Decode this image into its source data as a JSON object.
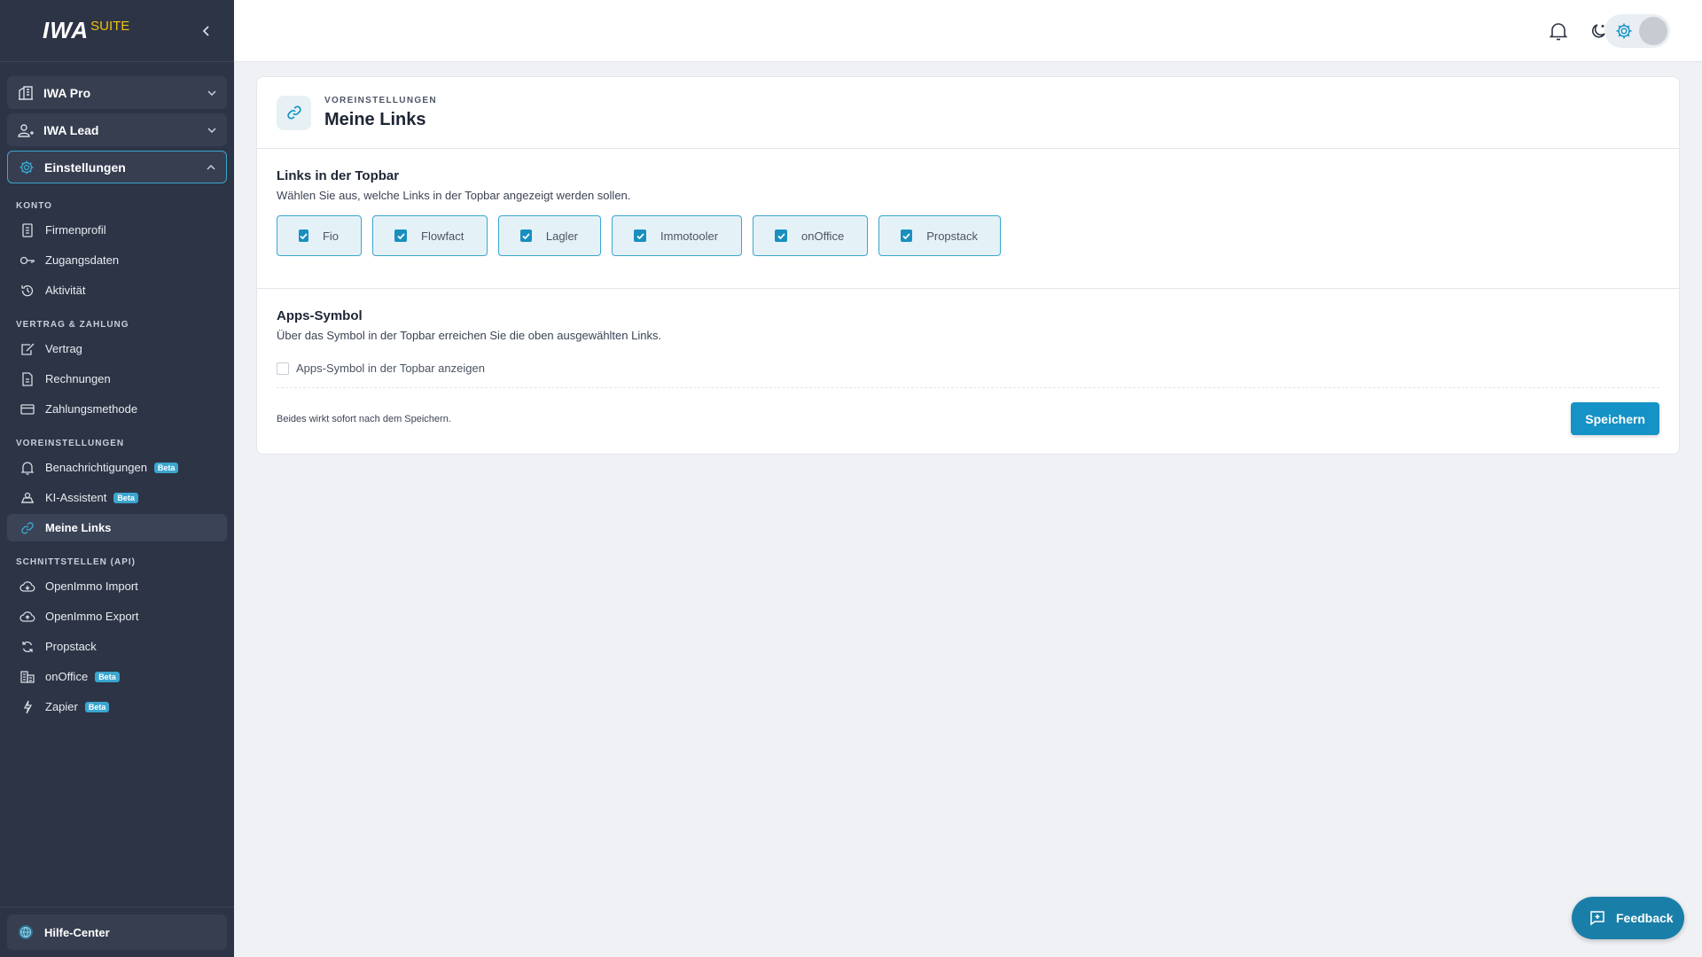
{
  "brand": {
    "name": "IWA",
    "suffix": "SUITE",
    "accent": "#f1c40f"
  },
  "colors": {
    "primary": "#1592c6",
    "sidebar": "#2d3445",
    "beta_badge": "#3aa6cf"
  },
  "sidebar": {
    "groups": [
      {
        "label": "IWA Pro",
        "icon": "building-icon",
        "expanded": false
      },
      {
        "label": "IWA Lead",
        "icon": "user-add-icon",
        "expanded": false
      },
      {
        "label": "Einstellungen",
        "icon": "gear-icon",
        "expanded": true
      }
    ],
    "sections": [
      {
        "title": "KONTO",
        "items": [
          {
            "label": "Firmenprofil",
            "icon": "document-icon"
          },
          {
            "label": "Zugangsdaten",
            "icon": "key-icon"
          },
          {
            "label": "Aktivität",
            "icon": "history-icon"
          }
        ]
      },
      {
        "title": "VERTRAG & ZAHLUNG",
        "items": [
          {
            "label": "Vertrag",
            "icon": "contract-icon"
          },
          {
            "label": "Rechnungen",
            "icon": "invoice-icon"
          },
          {
            "label": "Zahlungsmethode",
            "icon": "credit-card-icon"
          }
        ]
      },
      {
        "title": "VOREINSTELLUNGEN",
        "items": [
          {
            "label": "Benachrichtigungen",
            "icon": "bell-icon",
            "badge": "Beta"
          },
          {
            "label": "KI-Assistent",
            "icon": "robot-icon",
            "badge": "Beta"
          },
          {
            "label": "Meine Links",
            "icon": "link-icon",
            "active": true
          }
        ]
      },
      {
        "title": "SCHNITTSTELLEN (API)",
        "items": [
          {
            "label": "OpenImmo Import",
            "icon": "cloud-icon"
          },
          {
            "label": "OpenImmo Export",
            "icon": "cloud-icon"
          },
          {
            "label": "Propstack",
            "icon": "sync-icon"
          },
          {
            "label": "onOffice",
            "icon": "office-building-icon",
            "badge": "Beta"
          },
          {
            "label": "Zapier",
            "icon": "bolt-icon",
            "badge": "Beta"
          }
        ]
      }
    ],
    "help": {
      "label": "Hilfe-Center",
      "icon": "globe-icon"
    }
  },
  "topbar": {
    "icons": [
      "bell-icon",
      "moon-icon",
      "gear-icon"
    ]
  },
  "card": {
    "eyebrow": "VOREINSTELLUNGEN",
    "title": "Meine Links",
    "links_section": {
      "title": "Links in der Topbar",
      "description": "Wählen Sie aus, welche Links in der Topbar angezeigt werden sollen.",
      "links": [
        {
          "label": "Fio",
          "checked": true
        },
        {
          "label": "Flowfact",
          "checked": true
        },
        {
          "label": "Lagler",
          "checked": true
        },
        {
          "label": "Immotooler",
          "checked": true
        },
        {
          "label": "onOffice",
          "checked": true
        },
        {
          "label": "Propstack",
          "checked": true
        }
      ]
    },
    "apps_section": {
      "title": "Apps-Symbol",
      "description": "Über das Symbol in der Topbar erreichen Sie die oben ausgewählten Links.",
      "checkbox_label": "Apps-Symbol in der Topbar anzeigen",
      "checked": false
    },
    "footer_note": "Beides wirkt sofort nach dem Speichern.",
    "save_label": "Speichern"
  },
  "feedback": {
    "label": "Feedback"
  }
}
